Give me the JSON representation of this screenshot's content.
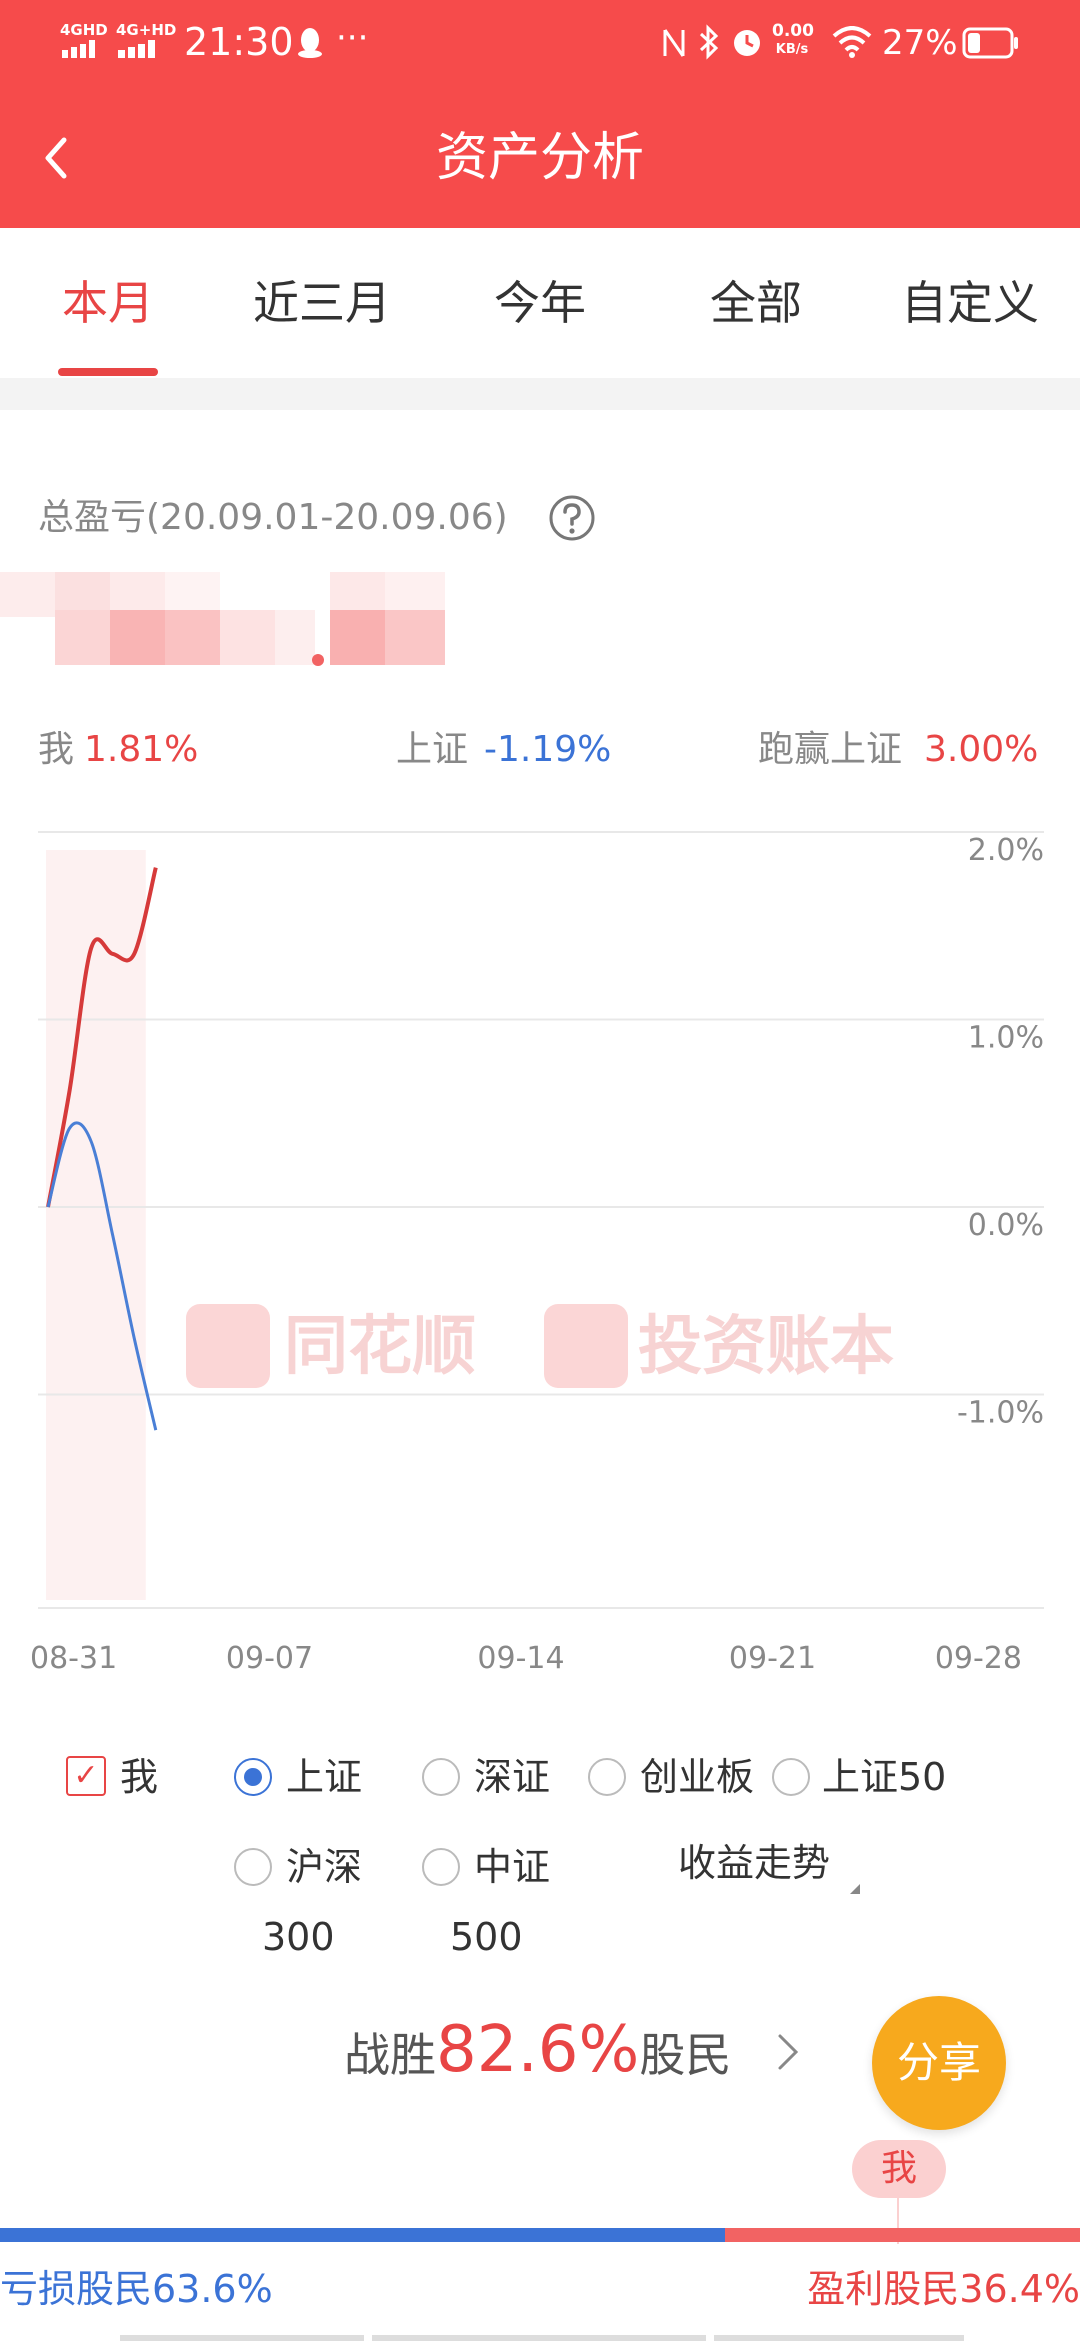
{
  "status_bar": {
    "time": "21:30",
    "network1": "4GHD",
    "network2": "4G+HD",
    "speed_value": "0.00",
    "speed_unit": "KB/s",
    "battery": "27%",
    "icons": [
      "qq-icon",
      "more-dots-icon",
      "nfc-icon",
      "bluetooth-icon",
      "alarm-icon",
      "wifi-icon",
      "battery-icon"
    ]
  },
  "header": {
    "title": "资产分析",
    "back_icon": "back-chevron-icon"
  },
  "tabs": [
    {
      "label": "本月",
      "active": true
    },
    {
      "label": "近三月",
      "active": false
    },
    {
      "label": "今年",
      "active": false
    },
    {
      "label": "全部",
      "active": false
    },
    {
      "label": "自定义",
      "active": false
    }
  ],
  "summary": {
    "label": "总盈亏(20.09.01-20.09.06)",
    "help_icon": "question-circle-icon",
    "me_label": "我",
    "me_value": "1.81%",
    "index_label": "上证",
    "index_value": "-1.19%",
    "beat_label": "跑赢上证",
    "beat_value": "3.00%"
  },
  "watermark": {
    "left": "同花顺",
    "right": "投资账本"
  },
  "chart_data": {
    "type": "line",
    "x_ticks": [
      "08-31",
      "09-07",
      "09-14",
      "09-21",
      "09-28"
    ],
    "y_ticks": [
      "2.0%",
      "1.0%",
      "0.0%",
      "-1.0%"
    ],
    "ylim": [
      -2.0,
      2.0
    ],
    "series": [
      {
        "name": "我",
        "color": "#d63a3a",
        "x": [
          0,
          0.6,
          1.2,
          1.8,
          2.4,
          3.0
        ],
        "values": [
          0.0,
          0.62,
          1.38,
          1.35,
          1.35,
          1.81
        ]
      },
      {
        "name": "上证",
        "color": "#4a7fd6",
        "x": [
          0,
          0.6,
          1.2,
          1.8,
          2.4,
          3.0
        ],
        "values": [
          0.0,
          0.42,
          0.35,
          -0.15,
          -0.7,
          -1.19
        ]
      }
    ],
    "highlight_range": [
      0,
      3.0
    ]
  },
  "options": {
    "me": "我",
    "sh": "上证",
    "sz": "深证",
    "cyb": "创业板",
    "sh50": "上证50",
    "hs300_a": "沪深",
    "hs300_b": "300",
    "zz500_a": "中证",
    "zz500_b": "500",
    "trend": "收益走势"
  },
  "beat": {
    "prefix": "战胜",
    "value": "82.6%",
    "suffix": "股民"
  },
  "share_label": "分享",
  "me_badge": "我",
  "distribution": {
    "loss_label": "亏损股民63.6%",
    "profit_label": "盈利股民36.4%",
    "loss_fraction": 0.636
  },
  "colors": {
    "brand_red": "#f64b4b",
    "accent_red": "#e84545",
    "blue": "#3b73d6",
    "share_orange": "#f7a91d"
  }
}
